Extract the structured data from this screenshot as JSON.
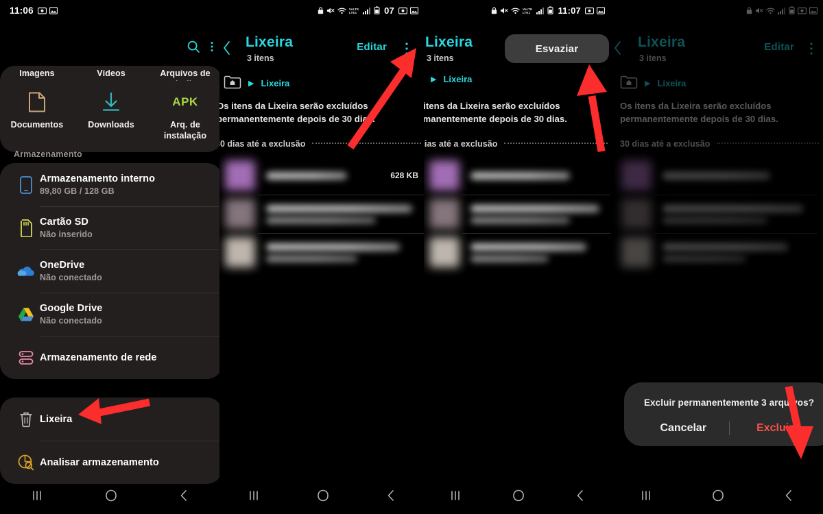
{
  "statusbars": [
    {
      "clock": "11:06",
      "left_icons": [
        "screenshot-icon",
        "picture-icon"
      ],
      "right_icons": [
        "lock-icon",
        "mute-icon",
        "wifi-icon",
        "volte-icon",
        "signal-icon",
        "battery-icon"
      ],
      "battery_text": "07",
      "right_extra": [
        "screenshot-icon",
        "picture-icon"
      ]
    },
    {
      "clock": "11:07",
      "left_icons": [],
      "right_icons": [
        "lock-icon",
        "mute-icon",
        "wifi-icon",
        "volte-icon",
        "signal-icon",
        "battery-icon"
      ],
      "battery_text": "",
      "right_extra": [
        "screenshot-icon",
        "picture-icon"
      ]
    }
  ],
  "panel1": {
    "header": {
      "search": "search-icon",
      "more": "more-vertical-icon",
      "back": "back-icon"
    },
    "categories_clipped": [
      {
        "label": "Imagens"
      },
      {
        "label": "Vídeos"
      },
      {
        "label": "Arquivos de áudio"
      }
    ],
    "categories": [
      {
        "label": "Documentos",
        "icon": "document-icon",
        "color": "#c9a678"
      },
      {
        "label": "Downloads",
        "icon": "download-icon",
        "color": "#2fb8c0"
      },
      {
        "label": "Arq. de instalação",
        "icon": "apk-icon",
        "color": "#a8d843",
        "glyph": "APK"
      }
    ],
    "section_title": "Armazenamento",
    "storage_items": [
      {
        "title": "Armazenamento interno",
        "sub": "89,80 GB / 128 GB",
        "icon": "phone-icon",
        "color": "#4a8fd6"
      },
      {
        "title": "Cartão SD",
        "sub": "Não inserido",
        "icon": "sdcard-icon",
        "color": "#d4d95a"
      },
      {
        "title": "OneDrive",
        "sub": "Não conectado",
        "icon": "onedrive-icon",
        "color": "#2f7fd1"
      },
      {
        "title": "Google Drive",
        "sub": "Não conectado",
        "icon": "googledrive-icon",
        "color": "#4caf50"
      },
      {
        "title": "Armazenamento de rede",
        "sub": "",
        "icon": "network-storage-icon",
        "color": "#e98aa8"
      }
    ],
    "tools": [
      {
        "title": "Lixeira",
        "sub": "",
        "icon": "trash-icon",
        "color": "#bdb8b4"
      },
      {
        "title": "Analisar armazenamento",
        "sub": "",
        "icon": "analyze-storage-icon",
        "color": "#d8a028"
      }
    ]
  },
  "trash": {
    "title": "Lixeira",
    "count": "3 itens",
    "edit_label": "Editar",
    "breadcrumb": "Lixeira",
    "note": "Os itens da Lixeira serão excluídos permanentemente depois de 30 dias.",
    "deadline_label": "30 dias até a exclusão",
    "files": [
      {
        "size": "628 KB",
        "thumb": "#b077c4"
      },
      {
        "size": "",
        "thumb": "#8f7f86"
      },
      {
        "size": "",
        "thumb": "#cfc6bd"
      }
    ]
  },
  "popup": {
    "empty_label": "Esvaziar"
  },
  "dialog": {
    "title": "Excluir permanentemente 3 arquivos?",
    "cancel_label": "Cancelar",
    "delete_label": "Excluir",
    "delete_color": "#f4524d"
  },
  "navbar": {
    "recents": "recents-icon",
    "home": "home-icon",
    "back": "back-icon"
  },
  "annotations": {
    "arrow_color": "#fc2d2d",
    "count": 4
  },
  "theme": {
    "accent": "#29d8e0",
    "card_bg": "#231f1e",
    "screen_bg": "#000000"
  }
}
